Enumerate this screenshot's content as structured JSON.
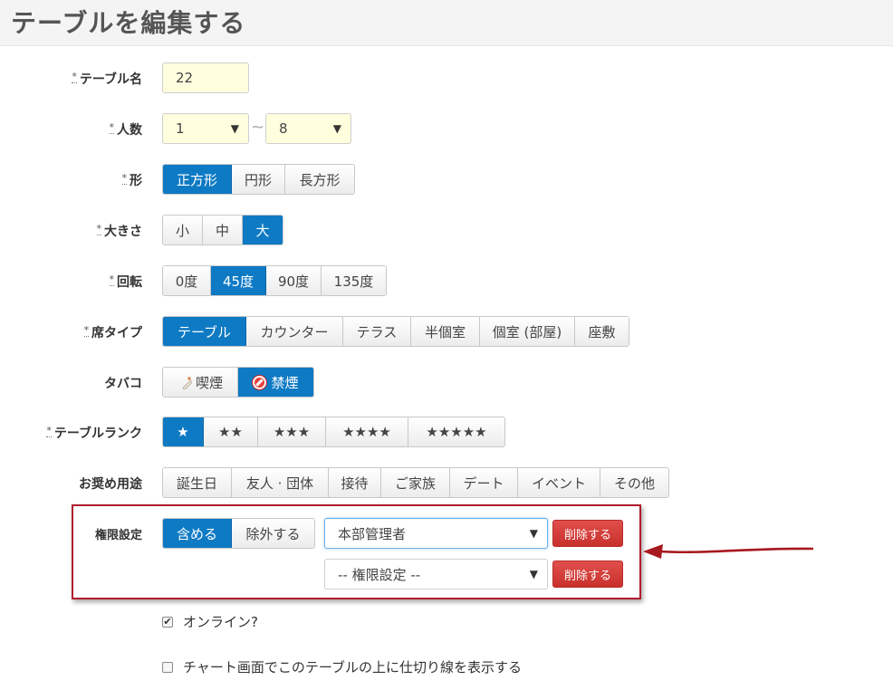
{
  "page": {
    "title": "テーブルを編集する"
  },
  "required_mark": "*",
  "table_name": {
    "label": "テーブル名",
    "value": "22"
  },
  "capacity": {
    "label": "人数",
    "min": "1",
    "max": "8",
    "separator": "~"
  },
  "shape": {
    "label": "形",
    "options": [
      "正方形",
      "円形",
      "長方形"
    ],
    "selected": "正方形"
  },
  "size": {
    "label": "大きさ",
    "options": [
      "小",
      "中",
      "大"
    ],
    "selected": "大"
  },
  "rotation": {
    "label": "回転",
    "options": [
      "0度",
      "45度",
      "90度",
      "135度"
    ],
    "selected": "45度"
  },
  "seat_type": {
    "label": "席タイプ",
    "options": [
      "テーブル",
      "カウンター",
      "テラス",
      "半個室",
      "個室 (部屋)",
      "座敷"
    ],
    "selected": "テーブル"
  },
  "tobacco": {
    "label": "タバコ",
    "options": [
      "喫煙",
      "禁煙"
    ],
    "selected": "禁煙"
  },
  "rank": {
    "label": "テーブルランク",
    "options": [
      "★",
      "★★",
      "★★★",
      "★★★★",
      "★★★★★"
    ],
    "selected": "★"
  },
  "purpose": {
    "label": "お奨め用途",
    "options": [
      "誕生日",
      "友人 · 団体",
      "接待",
      "ご家族",
      "デート",
      "イベント",
      "その他"
    ]
  },
  "permission": {
    "label": "権限設定",
    "mode_options": [
      "含める",
      "除外する"
    ],
    "mode_selected": "含める",
    "rows": [
      {
        "value": "本部管理者",
        "delete_label": "削除する"
      },
      {
        "value": "-- 権限設定 --",
        "delete_label": "削除する"
      }
    ]
  },
  "online": {
    "label": "オンライン?",
    "checked": true
  },
  "divider": {
    "label": "チャート画面でこのテーブルの上に仕切り線を表示する",
    "checked": false
  },
  "colors": {
    "accent": "#0e7ac4",
    "danger": "#d9534f",
    "highlight_box": "#b01c2e",
    "input_bg": "#ffffdd"
  }
}
